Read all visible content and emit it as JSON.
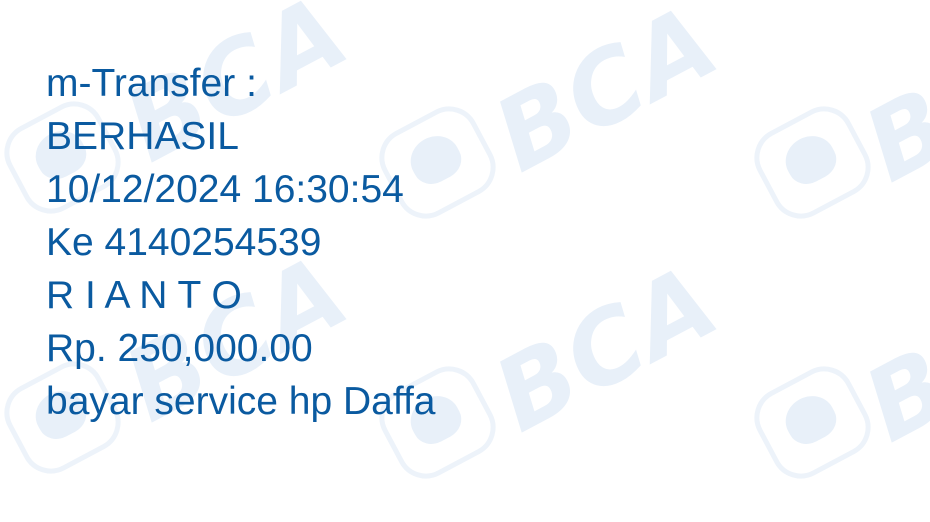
{
  "watermark": {
    "brand": "BCA",
    "color": "#e8f0f9"
  },
  "receipt": {
    "text_color": "#0a5aa0",
    "lines": [
      "m-Transfer :",
      "BERHASIL",
      "10/12/2024 16:30:54",
      "Ke 4140254539",
      "R I A N T O",
      "Rp. 250,000.00",
      "bayar service hp Daffa"
    ]
  }
}
